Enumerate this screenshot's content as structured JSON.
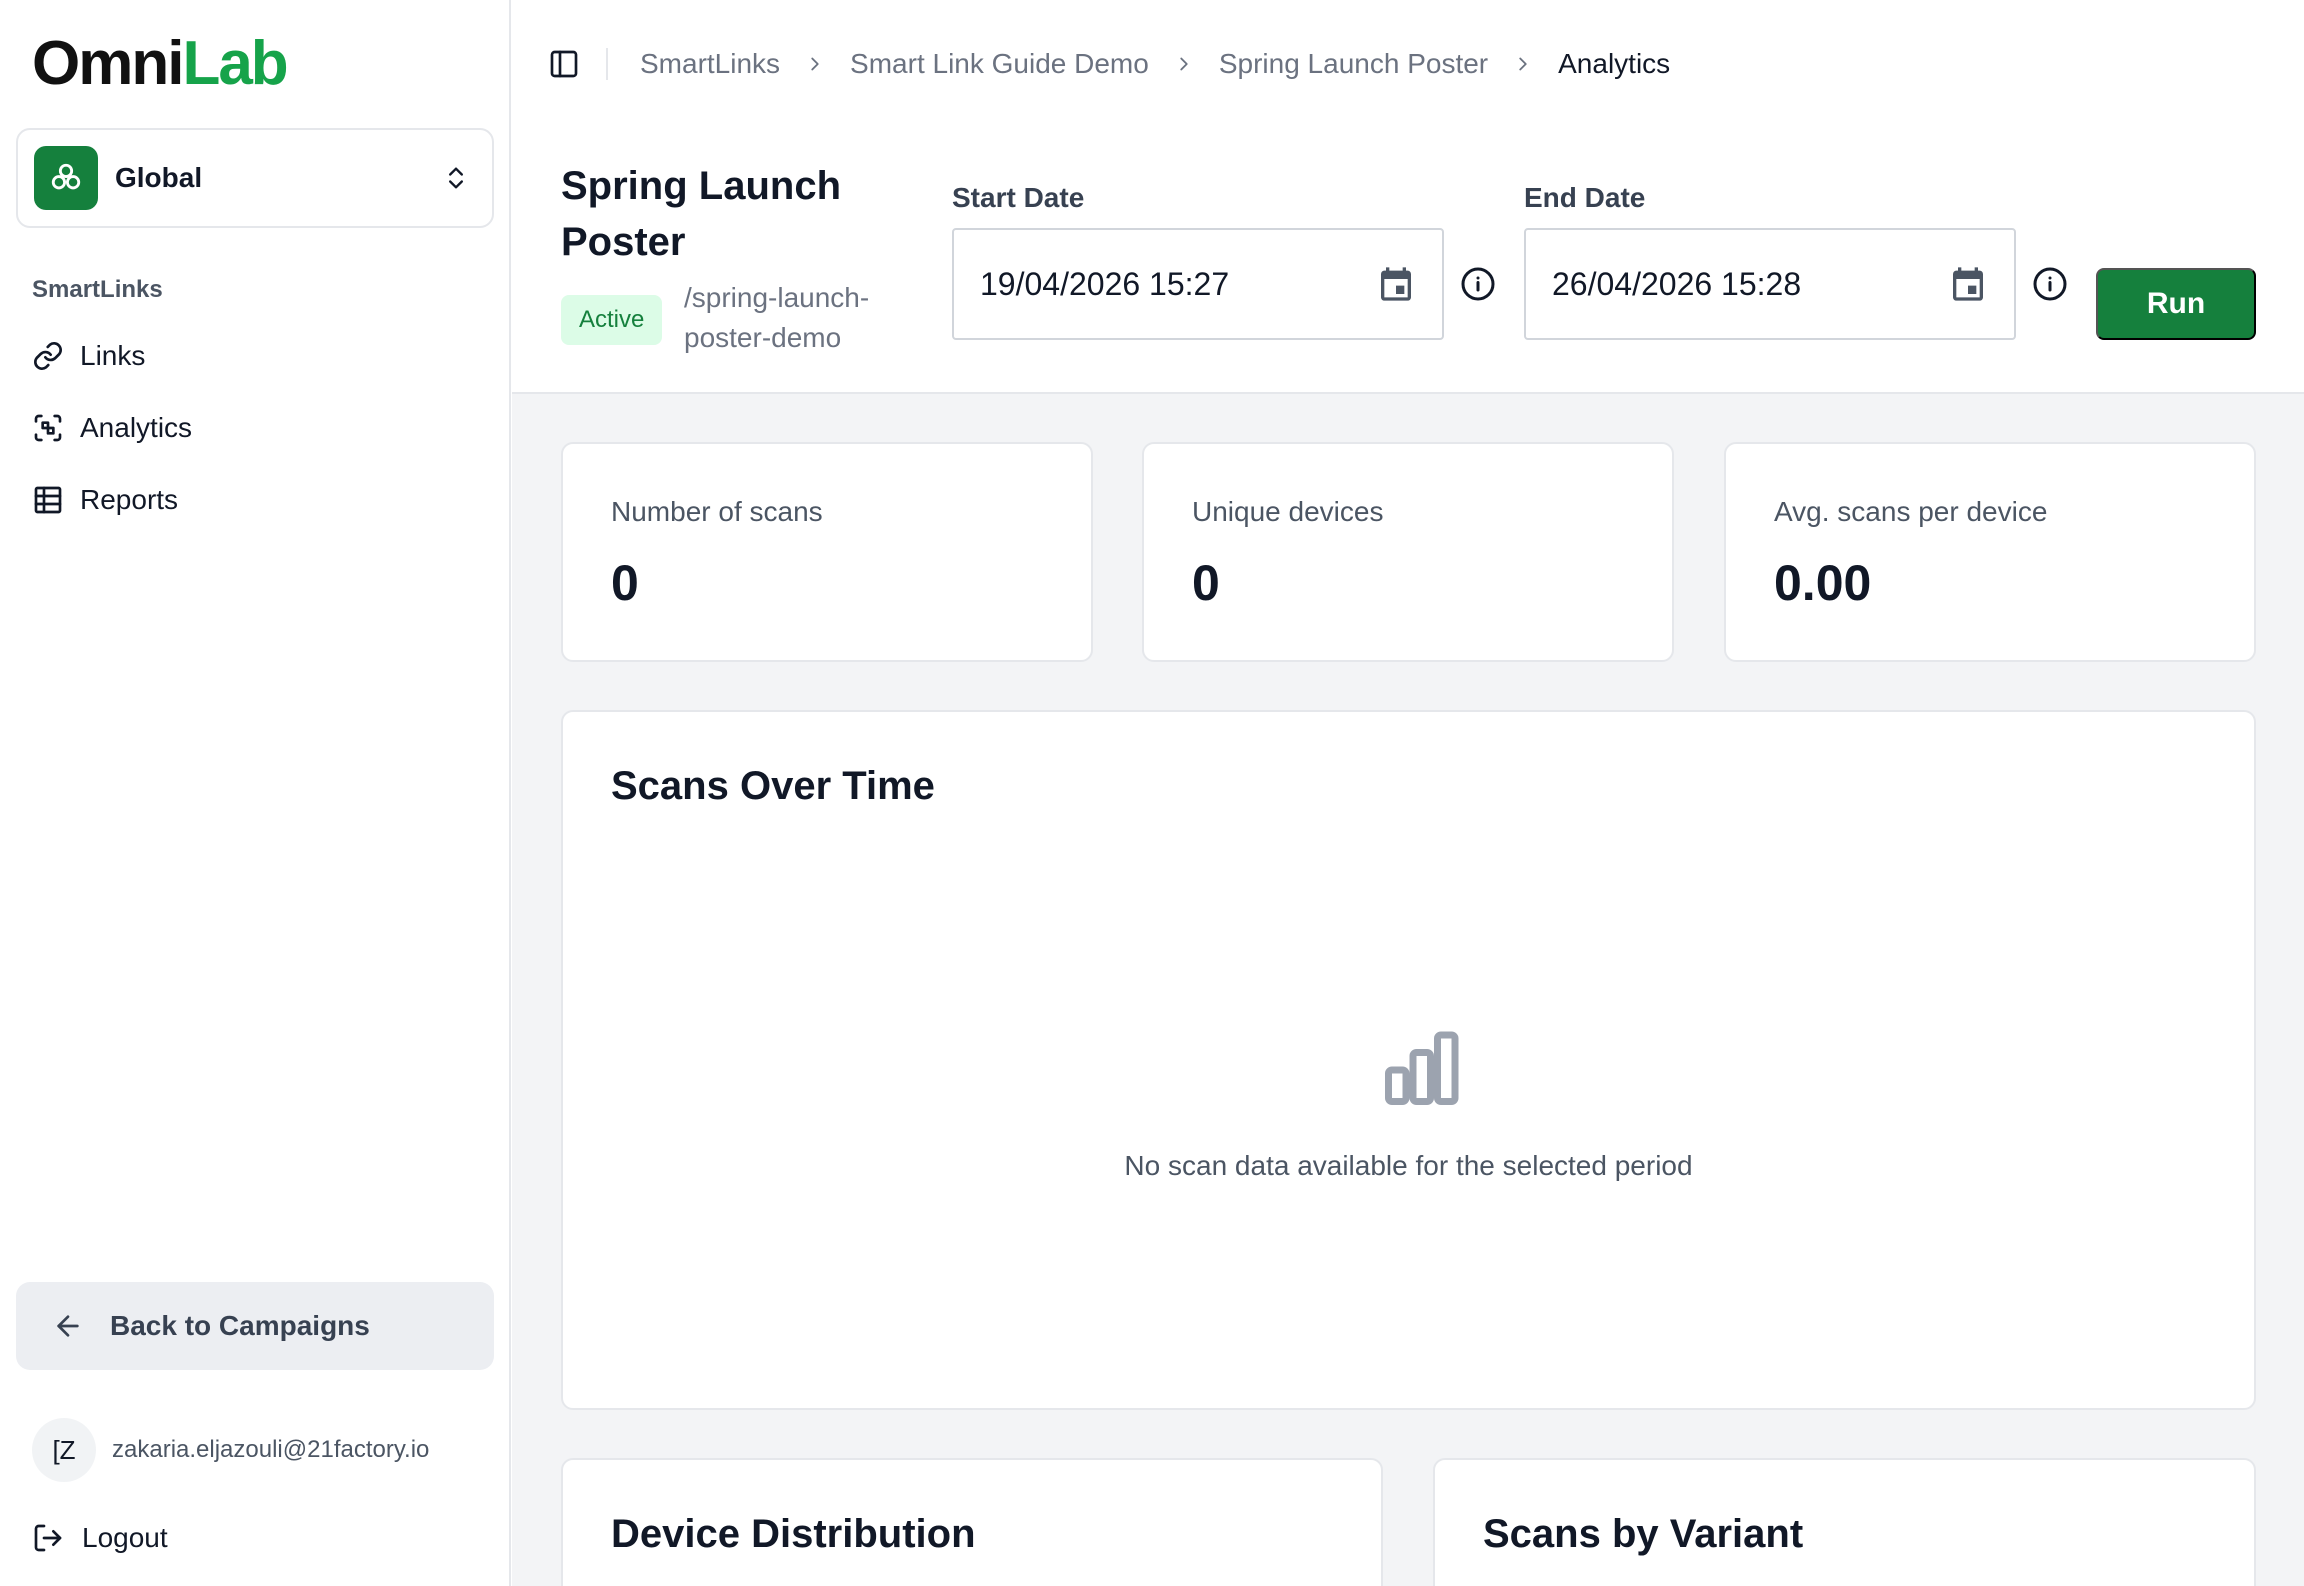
{
  "brand": {
    "name_part1": "Omni",
    "name_part2": "Lab",
    "accent": "#16a34a",
    "primary": "#15803d"
  },
  "org_switcher": {
    "name": "Global",
    "badge_icon": "clover-icon",
    "chevron_icon": "chevrons-up-down-icon"
  },
  "sidebar": {
    "section_label": "SmartLinks",
    "items": [
      {
        "label": "Links",
        "icon": "link-icon"
      },
      {
        "label": "Analytics",
        "icon": "scan-icon"
      },
      {
        "label": "Reports",
        "icon": "table-icon"
      }
    ],
    "back_button": "Back to Campaigns",
    "user": {
      "initials": "[Z",
      "email": "zakaria.eljazouli@21factory.io"
    },
    "logout": "Logout"
  },
  "breadcrumb": [
    "SmartLinks",
    "Smart Link Guide Demo",
    "Spring Launch Poster",
    "Analytics"
  ],
  "header": {
    "title": "Spring Launch Poster",
    "status": "Active",
    "slug": "/spring-launch-poster-demo",
    "start_date": {
      "label": "Start Date",
      "value": "19/04/2026 15:27"
    },
    "end_date": {
      "label": "End Date",
      "value": "26/04/2026 15:28"
    },
    "run_label": "Run"
  },
  "stats": [
    {
      "label": "Number of scans",
      "value": "0"
    },
    {
      "label": "Unique devices",
      "value": "0"
    },
    {
      "label": "Avg. scans per device",
      "value": "0.00"
    }
  ],
  "scans_over_time": {
    "title": "Scans Over Time",
    "empty_message": "No scan data available for the selected period",
    "empty_icon": "bar-chart-icon"
  },
  "bottom_cards": [
    {
      "title": "Device Distribution"
    },
    {
      "title": "Scans by Variant"
    }
  ]
}
